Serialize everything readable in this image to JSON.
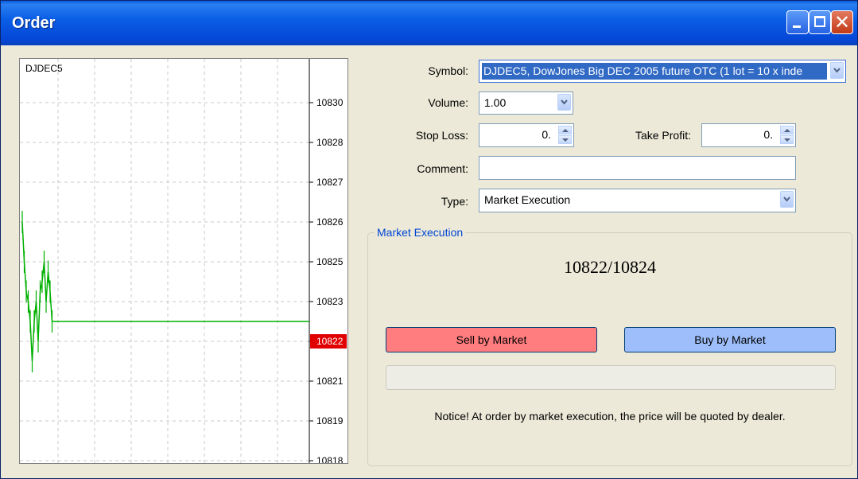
{
  "window": {
    "title": "Order"
  },
  "chart": {
    "symbol": "DJDEC5",
    "current_price_label": "10822",
    "current_price_color": "#E00000",
    "line_color": "#00B000"
  },
  "chart_data": {
    "type": "line",
    "title": "DJDEC5",
    "yticks": [
      "10830",
      "10828",
      "10827",
      "10826",
      "10825",
      "10823",
      "10822",
      "10821",
      "10819",
      "10818"
    ],
    "ylim": [
      10818,
      10830.5
    ],
    "grid": true,
    "series": [
      {
        "values": [
          10826,
          10825,
          10823.5,
          10823,
          10822.5,
          10821.5,
          10822.5,
          10823,
          10822,
          10823.5,
          10824,
          10825,
          10823,
          10824.5,
          10823.5,
          10822.5,
          10822.5,
          10822.5,
          10822.5,
          10822.5,
          10822.5,
          10822.5,
          10822.5,
          10822.5
        ]
      }
    ]
  },
  "form": {
    "symbol_label": "Symbol:",
    "symbol_value": "DJDEC5, DowJones Big DEC 2005 future OTC (1 lot = 10 x inde",
    "volume_label": "Volume:",
    "volume_value": "1.00",
    "stoploss_label": "Stop Loss:",
    "stoploss_value": "0.",
    "takeprofit_label": "Take Profit:",
    "takeprofit_value": "0.",
    "comment_label": "Comment:",
    "comment_value": "",
    "type_label": "Type:",
    "type_value": "Market Execution"
  },
  "market": {
    "group_title": "Market Execution",
    "price": "10822/10824",
    "sell_label": "Sell by Market",
    "buy_label": "Buy by Market",
    "notice": "Notice! At order by market execution, the price will be quoted by dealer."
  },
  "colors": {
    "sell": "#FF7D7F",
    "buy": "#9DBEFA",
    "titlebar": "#0548D8"
  }
}
